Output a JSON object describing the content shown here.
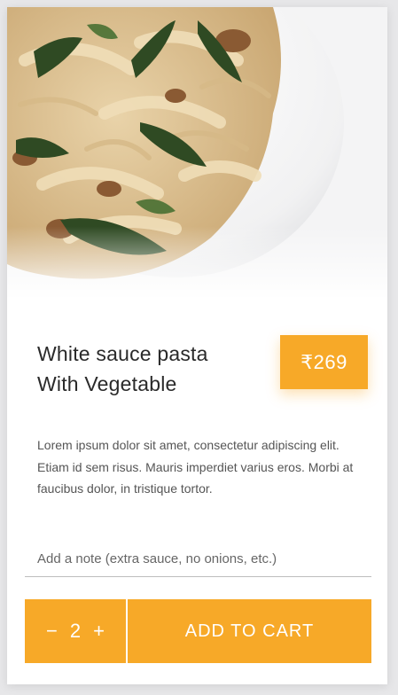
{
  "product": {
    "title_line1": "White sauce pasta",
    "title_line2": "With Vegetable",
    "price": "₹269",
    "description": "Lorem ipsum dolor sit amet, consectetur adipiscing elit. Etiam id sem risus. Mauris imperdiet varius eros. Morbi at faucibus dolor, in tristique tortor."
  },
  "note": {
    "placeholder": "Add a note (extra sauce, no onions, etc.)"
  },
  "cart": {
    "minus_label": "−",
    "quantity": "2",
    "plus_label": "+",
    "add_label": "ADD TO CART"
  },
  "colors": {
    "accent": "#f7a928",
    "text_dark": "#2a2a2a",
    "text_body": "#555555"
  },
  "icons": {
    "hero": "pasta-dish-photo"
  }
}
